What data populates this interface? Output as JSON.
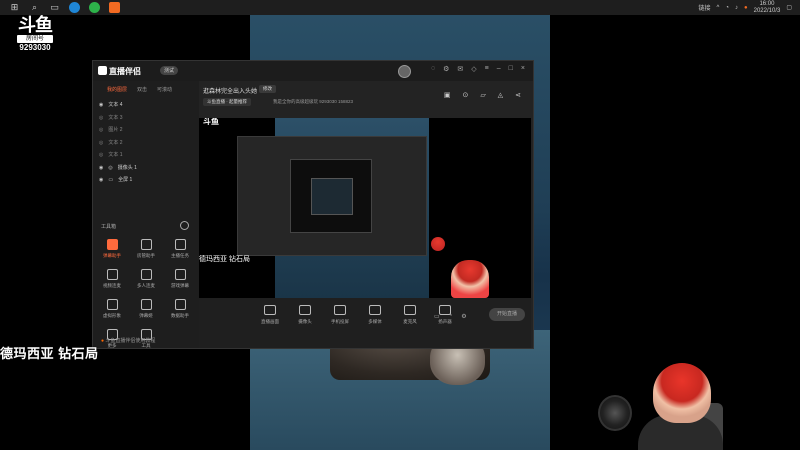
{
  "taskbar": {
    "icons": [
      "windows-icon",
      "search-icon",
      "taskview-icon",
      "edge-icon",
      "wechat-icon",
      "live-app-icon"
    ],
    "tray_text": "链接",
    "time": "16:00",
    "date": "2022/10/3"
  },
  "douyu": {
    "logo_text": "斗鱼",
    "room_label": "房间号",
    "room_number": "9293030"
  },
  "app": {
    "name": "直播伴侣",
    "beta": "测试",
    "tabs": [
      "我的图层",
      "双击",
      "可滚动"
    ],
    "layers": [
      {
        "name": "文本 4",
        "visible": true
      },
      {
        "name": "文本 3",
        "visible": false
      },
      {
        "name": "图片 2",
        "visible": false
      },
      {
        "name": "文本 2",
        "visible": false
      },
      {
        "name": "文本 1",
        "visible": false
      },
      {
        "name": "摄像头 1",
        "visible": true
      },
      {
        "name": "全屏 1",
        "visible": true
      }
    ],
    "tools_title": "工具箱",
    "tools": [
      {
        "label": "弹幕助手",
        "active": true
      },
      {
        "label": "房管助手",
        "active": false
      },
      {
        "label": "主播任务",
        "active": false
      },
      {
        "label": "视频连麦",
        "active": false
      },
      {
        "label": "多人连麦",
        "active": false
      },
      {
        "label": "游戏弹幕",
        "active": false
      },
      {
        "label": "虚拟形象",
        "active": false
      },
      {
        "label": "弹幕姬",
        "active": false
      },
      {
        "label": "数据助手",
        "active": false
      },
      {
        "label": "更多",
        "active": false
      },
      {
        "label": "工具",
        "active": false
      }
    ],
    "help_text": "斗鱼直播伴侣使用教程",
    "stream_title": "逛森林完全出入头她",
    "edit_label": "修改",
    "category": "斗鱼直播 · 起量推荐",
    "meta": "我是全你的高级超级玩  9293030   158823",
    "preview_caption": "德玛西亚 钻石局",
    "bottom_items": [
      "直播画面",
      "摄像头",
      "手机投屏",
      "多媒体",
      "麦克风",
      "扬声器"
    ],
    "start_button": "开始直播"
  },
  "overlay": {
    "text": "德玛西亚 钻石局"
  }
}
